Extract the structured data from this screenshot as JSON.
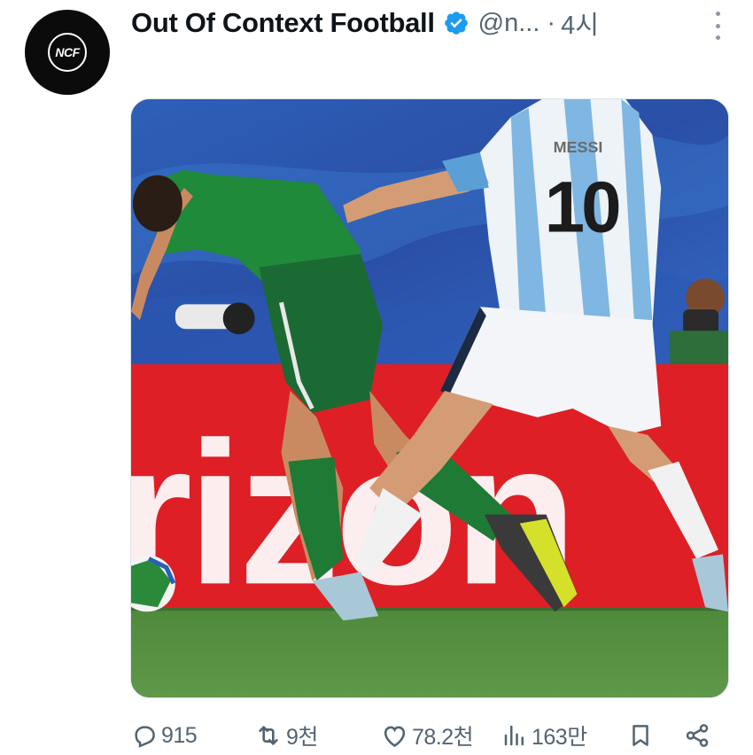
{
  "account": {
    "display_name": "Out Of Context Football",
    "handle": "@n...",
    "separator": "·",
    "time": "4시",
    "avatar_text": "NCF",
    "verified_color": "#1d9bf0"
  },
  "media": {
    "banner_text": "rizon",
    "player_name": "MESSI",
    "player_number": "10"
  },
  "actions": {
    "replies": "915",
    "reposts": "9천",
    "likes": "78.2천",
    "views": "163만"
  },
  "icons": [
    "more-vertical-icon",
    "verified-badge-icon",
    "reply-icon",
    "repost-icon",
    "like-icon",
    "views-icon",
    "bookmark-icon",
    "share-icon"
  ],
  "colors": {
    "text_primary": "#0f1419",
    "text_secondary": "#536471",
    "accent": "#1d9bf0"
  }
}
